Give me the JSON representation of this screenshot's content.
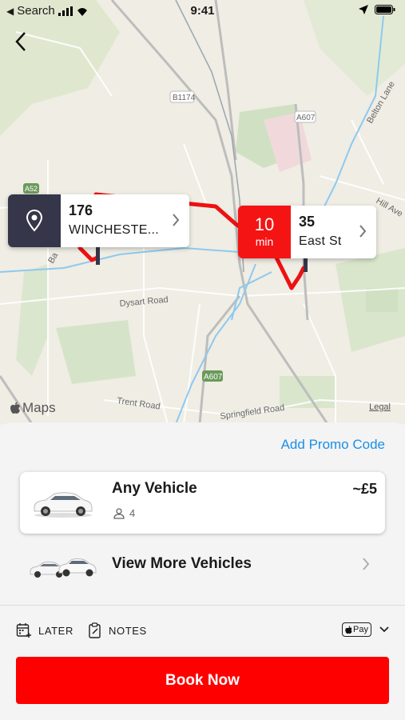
{
  "status_bar": {
    "carrier": "Search",
    "time": "9:41"
  },
  "map": {
    "labels": {
      "b1174": "B1174",
      "a607_top": "A607",
      "a52": "A52",
      "belton_lane": "Belton Lane",
      "hill_ave": "Hill Ave",
      "dysart_road": "Dysart Road",
      "a607_bottom": "A607",
      "trent_road": "Trent Road",
      "springfield_road": "Springfield Road",
      "barrowby": "Ba"
    },
    "maps_brand": "Maps",
    "legal": "Legal"
  },
  "origin_pin": {
    "number": "176",
    "street": "WINCHESTE..."
  },
  "destination_pin": {
    "eta_value": "10",
    "eta_unit": "min",
    "number": "35",
    "street": "East St"
  },
  "sheet": {
    "promo_label": "Add Promo Code",
    "vehicle": {
      "name": "Any Vehicle",
      "seats": "4",
      "price": "~£5"
    },
    "more_label": "View More Vehicles",
    "options": {
      "later": "LATER",
      "notes": "NOTES",
      "pay": "Pay"
    },
    "book_label": "Book Now"
  },
  "colors": {
    "accent_red": "#ff0000",
    "pin_dark": "#36364a",
    "link_blue": "#1a8fe8"
  }
}
